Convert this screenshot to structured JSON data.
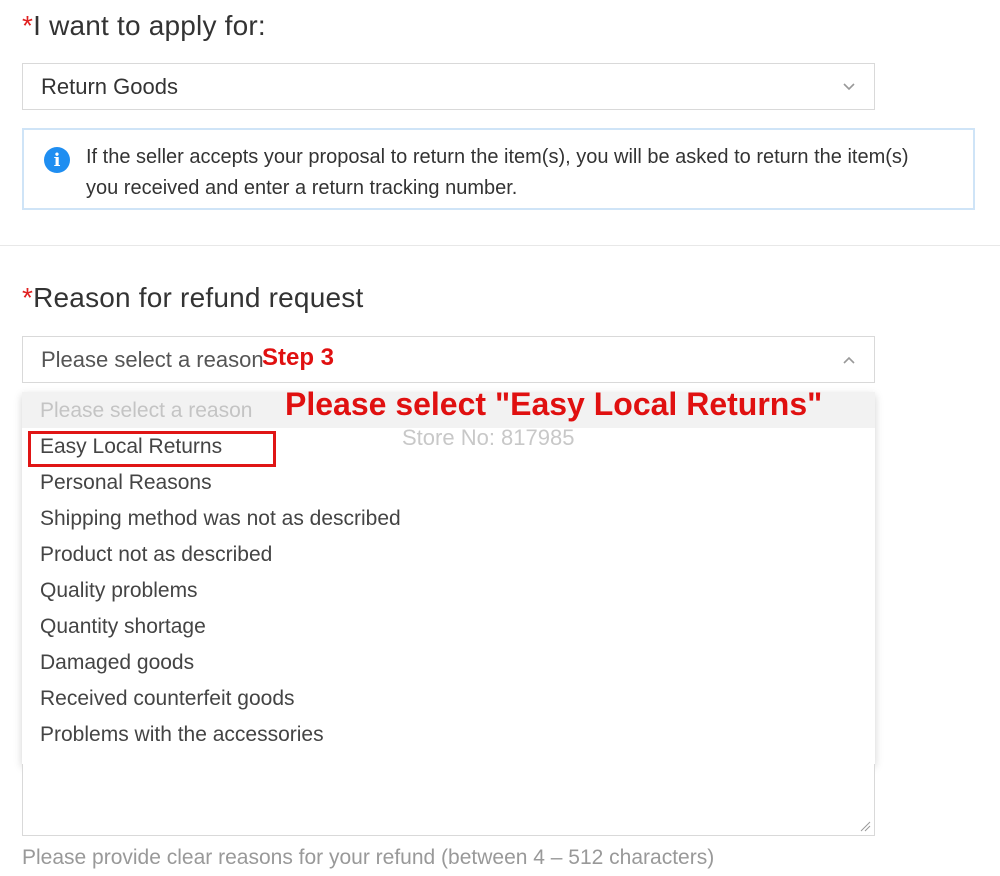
{
  "apply_section": {
    "required_marker": "*",
    "label": "I want to apply for:",
    "selected_value": "Return Goods",
    "chevron_icon": "chevron-down-icon"
  },
  "info_notice": {
    "icon": "info-icon",
    "icon_glyph": "i",
    "text": "If the seller accepts your proposal to return the item(s), you will be asked to return the item(s) you received and enter a return tracking number."
  },
  "reason_section": {
    "required_marker": "*",
    "label": "Reason for refund request",
    "select_placeholder": "Please select a reason",
    "chevron_icon": "chevron-up-icon",
    "dropdown_placeholder": "Please select a reason",
    "options": [
      "Easy Local Returns",
      "Personal Reasons",
      "Shipping method was not as described",
      "Product not as described",
      "Quality problems",
      "Quantity shortage",
      "Damaged goods",
      "Received counterfeit goods",
      "Problems with the accessories"
    ],
    "hint": "Please provide clear reasons for your refund (between 4 – 512 characters)"
  },
  "annotations": {
    "step": "Step 3",
    "instruction": "Please select \"Easy Local Returns\"",
    "watermark": "Store No: 817985",
    "accent_color": "#e01010"
  },
  "colors": {
    "info_blue": "#1f8ef1",
    "info_border": "#cfe4f7",
    "required_red": "#e02020"
  }
}
